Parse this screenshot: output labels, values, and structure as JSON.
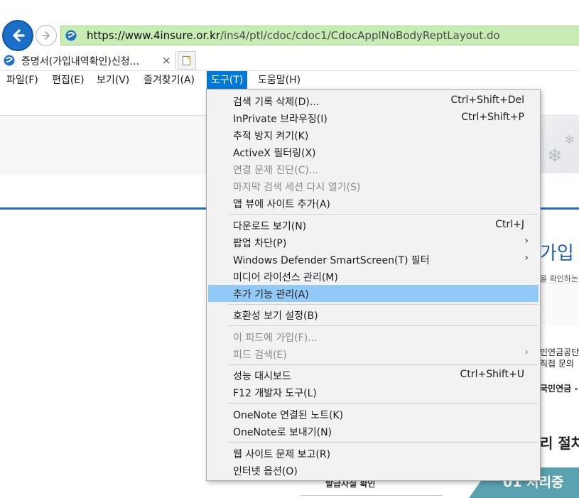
{
  "address": {
    "url_host": "https://www.4insure.or.kr",
    "url_path": "/ins4/ptl/cdoc/cdoc1/CdocApplNoBodyReptLayout.do"
  },
  "tab": {
    "title": "증명서(가입내역확인)신청...",
    "close": "×"
  },
  "menubar": {
    "file": "파일(F)",
    "edit": "편집(E)",
    "view": "보기(V)",
    "favorites": "즐겨찾기(A)",
    "tools": "도구(T)",
    "help": "도움말(H)"
  },
  "tools_menu": {
    "items": [
      {
        "label": "검색 기록 삭제(D)...",
        "shortcut": "Ctrl+Shift+Del"
      },
      {
        "label": "InPrivate 브라우징(I)",
        "shortcut": "Ctrl+Shift+P"
      },
      {
        "label": "추적 방지 켜기(K)"
      },
      {
        "label": "ActiveX 필터링(X)"
      },
      {
        "label": "연결 문제 진단(C)...",
        "disabled": true
      },
      {
        "label": "마지막 검색 세션 다시 열기(S)",
        "disabled": true
      },
      {
        "label": "앱 뷰에 사이트 추가(A)"
      },
      {
        "label": "다운로드 보기(N)",
        "shortcut": "Ctrl+J"
      },
      {
        "label": "팝업 차단(P)",
        "arrow": "›"
      },
      {
        "label": "Windows Defender SmartScreen(T) 필터",
        "arrow": "›"
      },
      {
        "label": "미디어 라이선스 관리(M)"
      },
      {
        "label": "추가 기능 관리(A)",
        "highlighted": true
      },
      {
        "label": "호환성 보기 설정(B)"
      },
      {
        "label": "이 피드에 가입(F)...",
        "disabled": true
      },
      {
        "label": "피드 검색(E)",
        "arrow": "›",
        "disabled": true
      },
      {
        "label": "성능 대시보드",
        "shortcut": "Ctrl+Shift+U"
      },
      {
        "label": "F12 개발자 도구(L)"
      },
      {
        "label": "OneNote 연결된 노트(K)"
      },
      {
        "label": "OneNote로 보내기(N)"
      },
      {
        "label": "웹 사이트 문제 보고(R)"
      },
      {
        "label": "인터넷 옵션(O)"
      }
    ]
  },
  "page": {
    "side_title": "가입",
    "side_sub": "을 확인하는",
    "side_text1": "민연금공단",
    "side_text2": "직접 문의",
    "side_text3": "국민연금 -",
    "side_heading": "리 절차",
    "bottom_label": "발급사실 확인",
    "teal_text": "01 처리중"
  }
}
